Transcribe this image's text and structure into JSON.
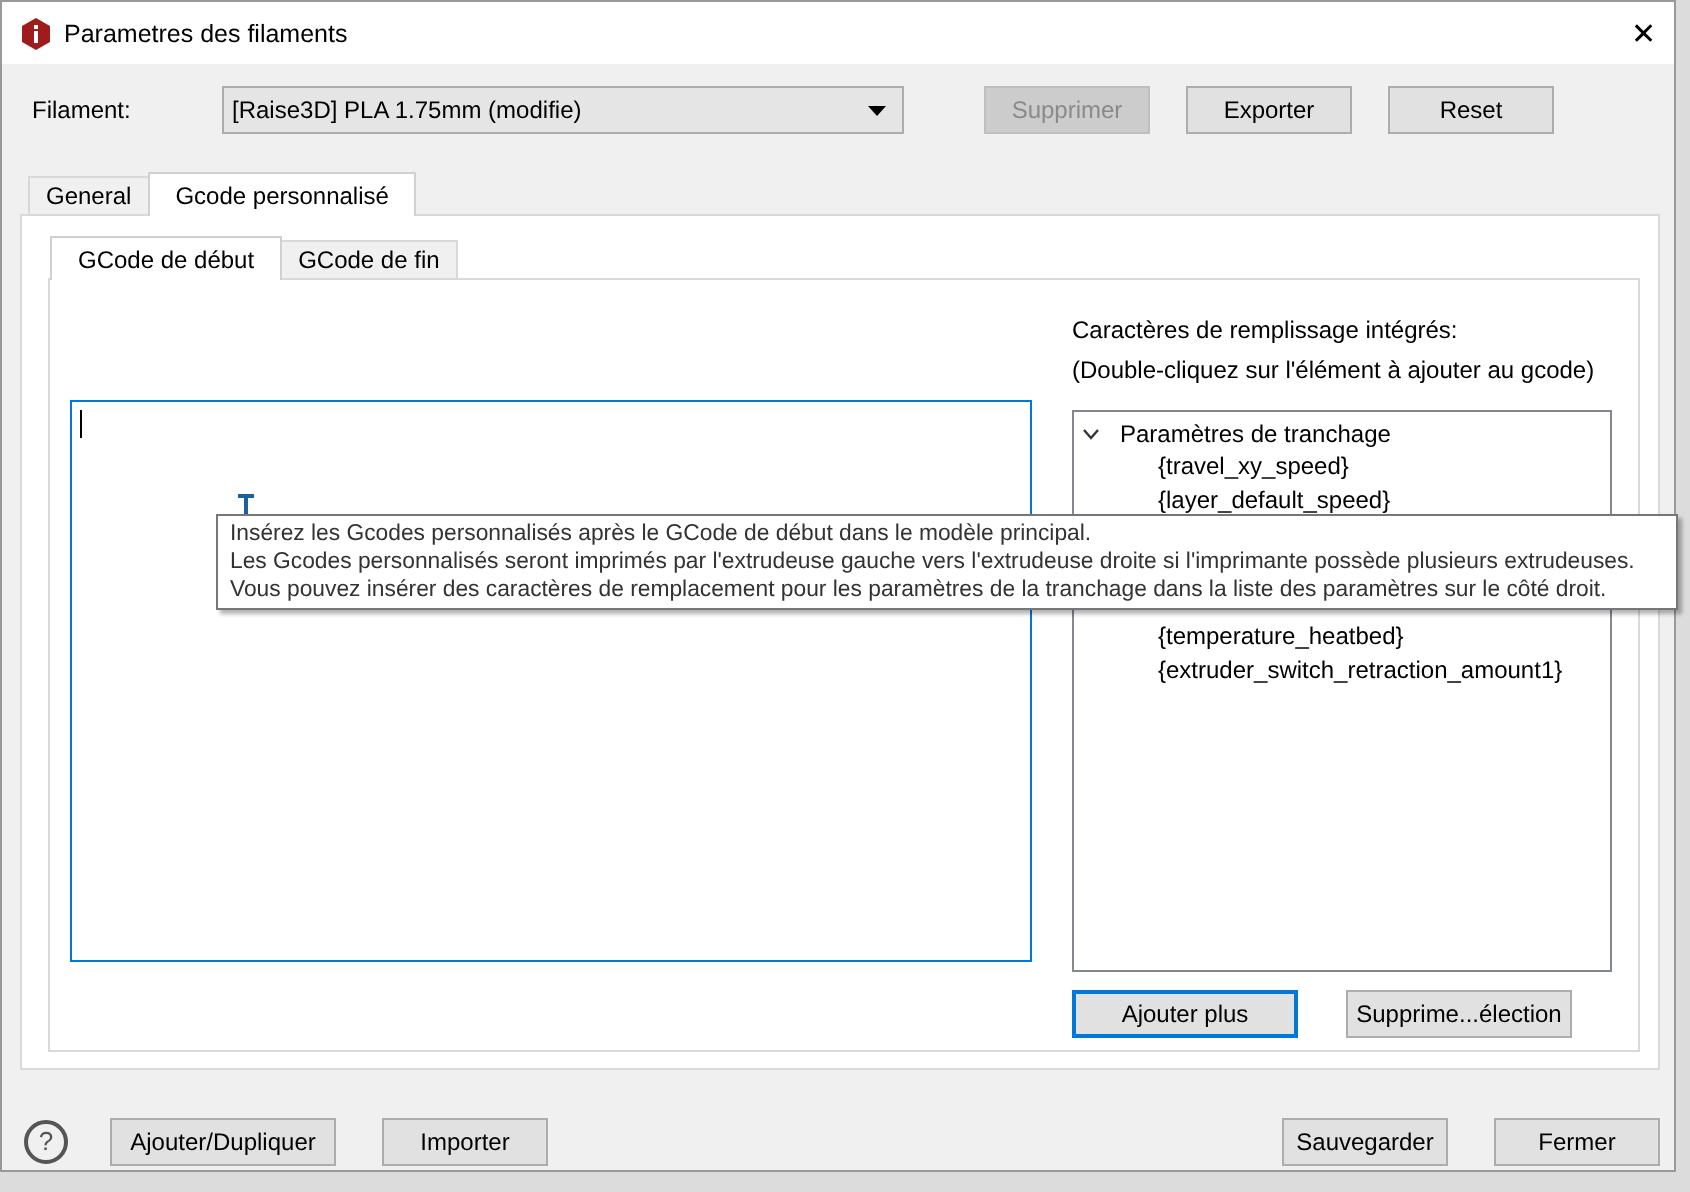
{
  "window": {
    "title": "Parametres des filaments",
    "close": "✕"
  },
  "filament": {
    "label": "Filament:",
    "value": "[Raise3D] PLA 1.75mm (modifie)"
  },
  "top_buttons": [
    {
      "label": "Supprimer",
      "disabled": true
    },
    {
      "label": "Exporter",
      "disabled": false
    },
    {
      "label": "Reset",
      "disabled": false
    }
  ],
  "tabs": [
    {
      "label": "General",
      "selected": false
    },
    {
      "label": "Gcode personnalisé",
      "selected": true
    }
  ],
  "subtabs": [
    {
      "label": "GCode de début",
      "selected": true
    },
    {
      "label": "GCode de fin",
      "selected": false
    }
  ],
  "placeholders": {
    "title": "Caractères de remplissage intégrés:",
    "hint": "(Double-cliquez sur l'élément à ajouter au gcode)",
    "tree": {
      "label": "Paramètres de tranchage",
      "expanded": true,
      "children": [
        {
          "label": "{travel_xy_speed}"
        },
        {
          "label": "{layer_default_speed}"
        },
        {
          "label": "{temperature_heatbed}"
        },
        {
          "label": "{extruder_switch_retraction_amount1}"
        }
      ]
    },
    "buttons": [
      {
        "label": "Ajouter plus",
        "focused": true
      },
      {
        "label": "Supprime...élection",
        "focused": false
      }
    ]
  },
  "tooltip": [
    "Insérez les Gcodes personnalisés après le GCode de début dans le modèle principal.",
    "Les Gcodes personnalisés seront imprimés par l'extrudeuse gauche vers l'extrudeuse droite si l'imprimante possède plusieurs extrudeuses.",
    "Vous pouvez insérer des caractères de remplacement pour les paramètres de la tranchage dans la liste des paramètres sur le côté droit."
  ],
  "footer": {
    "help": "?",
    "left": [
      "Ajouter/Dupliquer",
      "Importer"
    ],
    "right": [
      "Sauvegarder",
      "Fermer"
    ]
  }
}
